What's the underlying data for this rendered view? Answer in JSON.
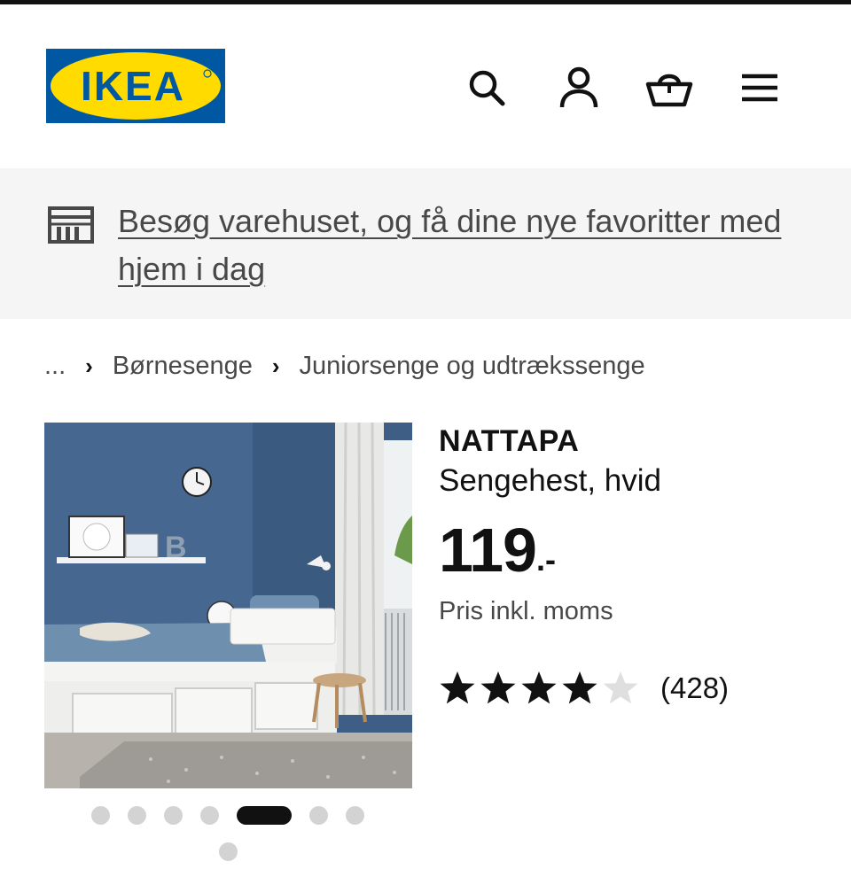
{
  "brand": {
    "logo_text": "IKEA",
    "logo_blue": "#0058a3",
    "logo_yellow": "#ffdb00"
  },
  "header": {
    "icons": [
      "search-icon",
      "profile-icon",
      "shopping-basket-icon",
      "hamburger-menu-icon"
    ]
  },
  "banner": {
    "icon": "store-icon",
    "link_text": "Besøg varehuset, og få dine nye favoritter med hjem i dag"
  },
  "breadcrumb": {
    "ellipsis": "...",
    "items": [
      "Børnesenge",
      "Juniorsenge og udtrækssenge"
    ]
  },
  "product": {
    "name": "NATTAPA",
    "description": "Sengehest, hvid",
    "price": "119",
    "price_suffix": ".-",
    "vat_note": "Pris inkl. moms",
    "rating": {
      "stars": 4,
      "max": 5,
      "count": "(428)"
    }
  },
  "carousel": {
    "total_images": 8,
    "active_index": 4
  },
  "colors": {
    "banner_bg": "#f5f5f5",
    "text_primary": "#111111",
    "text_secondary": "#484848",
    "dot_inactive": "#d3d3d3"
  }
}
